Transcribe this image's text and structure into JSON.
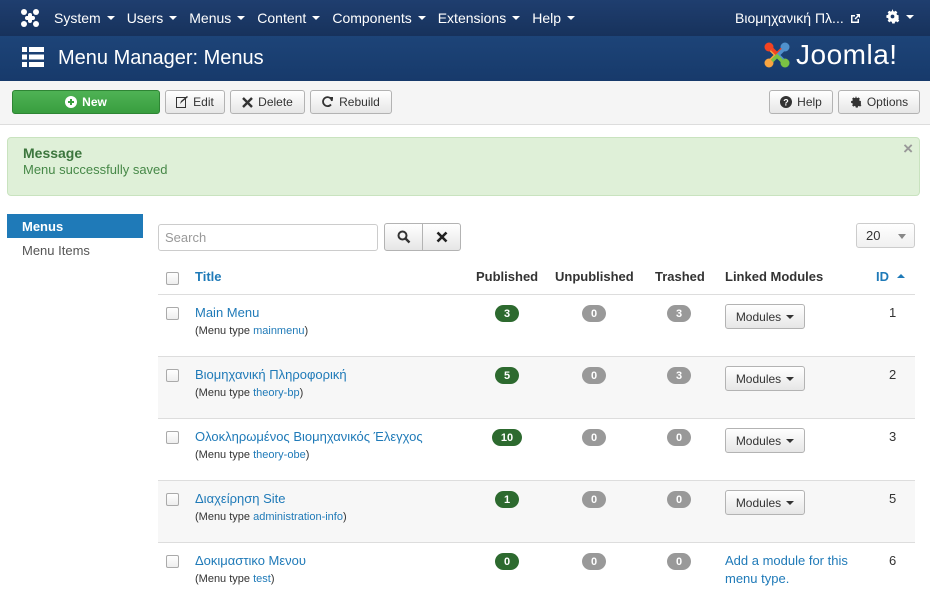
{
  "topnav": {
    "items": [
      "System",
      "Users",
      "Menus",
      "Content",
      "Components",
      "Extensions",
      "Help"
    ],
    "site_name": "Βιομηχανική Πλ..."
  },
  "header": {
    "title": "Menu Manager: Menus",
    "logo_text": "Joomla!"
  },
  "toolbar": {
    "new_label": "New",
    "edit_label": "Edit",
    "delete_label": "Delete",
    "rebuild_label": "Rebuild",
    "help_label": "Help",
    "options_label": "Options"
  },
  "message": {
    "heading": "Message",
    "text": "Menu successfully saved",
    "close": "×"
  },
  "sidebar": {
    "items": [
      "Menus",
      "Menu Items"
    ]
  },
  "search": {
    "placeholder": "Search",
    "limit": "20"
  },
  "table": {
    "headers": {
      "title": "Title",
      "published": "Published",
      "unpublished": "Unpublished",
      "trashed": "Trashed",
      "linked": "Linked Modules",
      "id": "ID"
    },
    "menu_type_prefix": "(Menu type ",
    "menu_type_suffix": ")",
    "modules_label": "Modules",
    "add_module_label": "Add a module for this menu type.",
    "rows": [
      {
        "title": "Main Menu",
        "menutype": "mainmenu",
        "published": "3",
        "unpublished": "0",
        "trashed": "3",
        "id": "1"
      },
      {
        "title": "Βιομηχανική Πληροφορική",
        "menutype": "theory-bp",
        "published": "5",
        "unpublished": "0",
        "trashed": "3",
        "id": "2"
      },
      {
        "title": "Ολοκληρωμένος Βιομηχανικός Έλεγχος",
        "menutype": "theory-obe",
        "published": "10",
        "unpublished": "0",
        "trashed": "0",
        "id": "3"
      },
      {
        "title": "Διαχείρηση Site",
        "menutype": "administration-info",
        "published": "1",
        "unpublished": "0",
        "trashed": "0",
        "id": "5"
      },
      {
        "title": "Δοκιμαστικο Μενου",
        "menutype": "test",
        "published": "0",
        "unpublished": "0",
        "trashed": "0",
        "id": "6"
      }
    ]
  },
  "colors": {
    "nav_bg": "#1a3867",
    "link": "#1f7ab8",
    "success_bg": "#dff0d8",
    "badge_green": "#2d6a2f",
    "badge_grey": "#999999",
    "new_button": "#46a546"
  }
}
